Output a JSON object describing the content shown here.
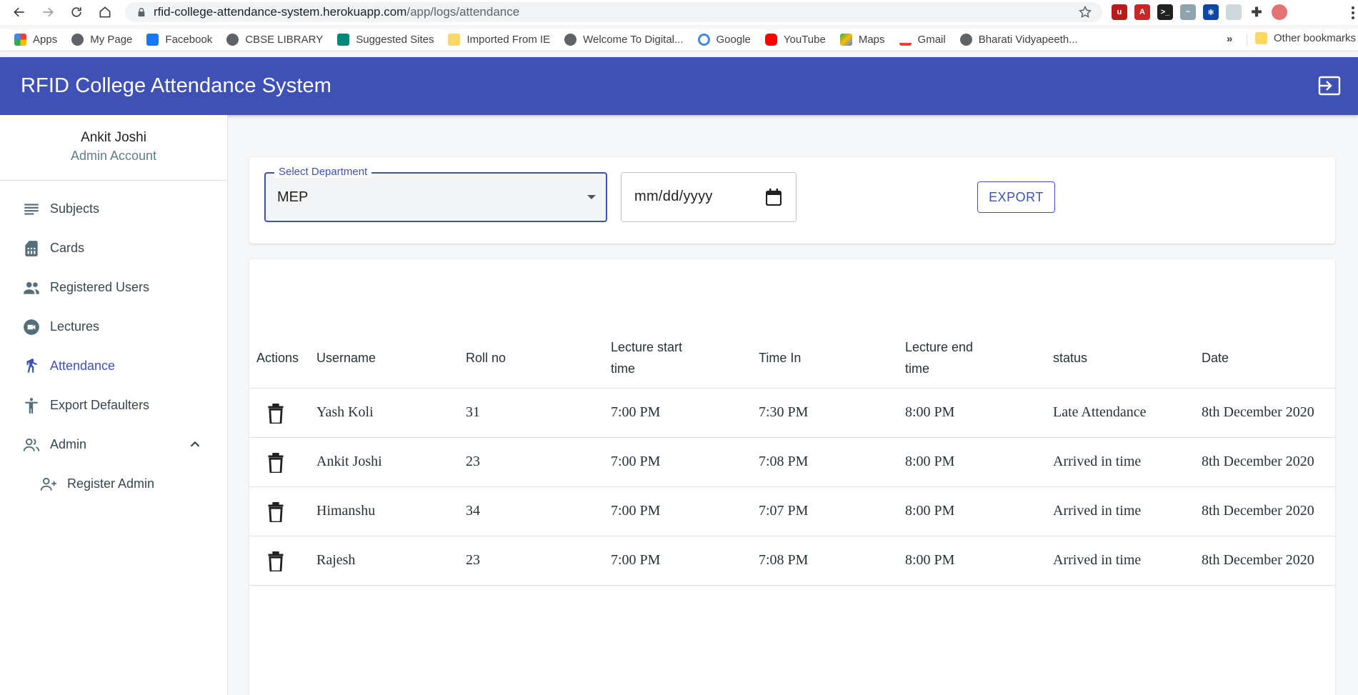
{
  "browser": {
    "url_host": "rfid-college-attendance-system.herokuapp.com",
    "url_path": "/app/logs/attendance",
    "bookmarks": [
      "Apps",
      "My Page",
      "Facebook",
      "CBSE LIBRARY",
      "Suggested Sites",
      "Imported From IE",
      "Welcome To Digital...",
      "Google",
      "YouTube",
      "Maps",
      "Gmail",
      "Bharati Vidyapeeth..."
    ],
    "bookmarks_more": "»",
    "other_bookmarks": "Other bookmarks"
  },
  "app": {
    "title": "RFID College Attendance System"
  },
  "profile": {
    "name": "Ankit Joshi",
    "role": "Admin Account"
  },
  "sidebar": {
    "items": [
      {
        "label": "Subjects",
        "icon": "list-icon"
      },
      {
        "label": "Cards",
        "icon": "sim-card-icon"
      },
      {
        "label": "Registered Users",
        "icon": "people-icon"
      },
      {
        "label": "Lectures",
        "icon": "video-icon"
      },
      {
        "label": "Attendance",
        "icon": "walk-icon",
        "active": true
      },
      {
        "label": "Export Defaulters",
        "icon": "accessibility-icon"
      },
      {
        "label": "Admin",
        "icon": "person-outline-icon",
        "expanded": true
      },
      {
        "label": "Register Admin",
        "icon": "person-add-icon",
        "sub": true
      }
    ]
  },
  "filters": {
    "department_label": "Select Department",
    "department_value": "MEP",
    "date_placeholder": "mm/dd/yyyy",
    "export_label": "EXPORT"
  },
  "table": {
    "headers": {
      "actions": "Actions",
      "username": "Username",
      "roll": "Roll no",
      "start_1": "Lecture start",
      "start_2": "time",
      "time_in": "Time In",
      "end_1": "Lecture end",
      "end_2": "time",
      "status": "status",
      "date": "Date"
    },
    "rows": [
      {
        "username": "Yash Koli",
        "roll": "31",
        "start": "7:00 PM",
        "time_in": "7:30 PM",
        "end": "8:00 PM",
        "status": "Late Attendance",
        "date": "8th December 2020"
      },
      {
        "username": "Ankit Joshi",
        "roll": "23",
        "start": "7:00 PM",
        "time_in": "7:08 PM",
        "end": "8:00 PM",
        "status": "Arrived in time",
        "date": "8th December 2020"
      },
      {
        "username": "Himanshu",
        "roll": "34",
        "start": "7:00 PM",
        "time_in": "7:07 PM",
        "end": "8:00 PM",
        "status": "Arrived in time",
        "date": "8th December 2020"
      },
      {
        "username": "Rajesh",
        "roll": "23",
        "start": "7:00 PM",
        "time_in": "7:08 PM",
        "end": "8:00 PM",
        "status": "Arrived in time",
        "date": "8th December 2020"
      }
    ]
  },
  "colors": {
    "primary": "#3f51b5",
    "appbar_text": "#ffffff"
  }
}
